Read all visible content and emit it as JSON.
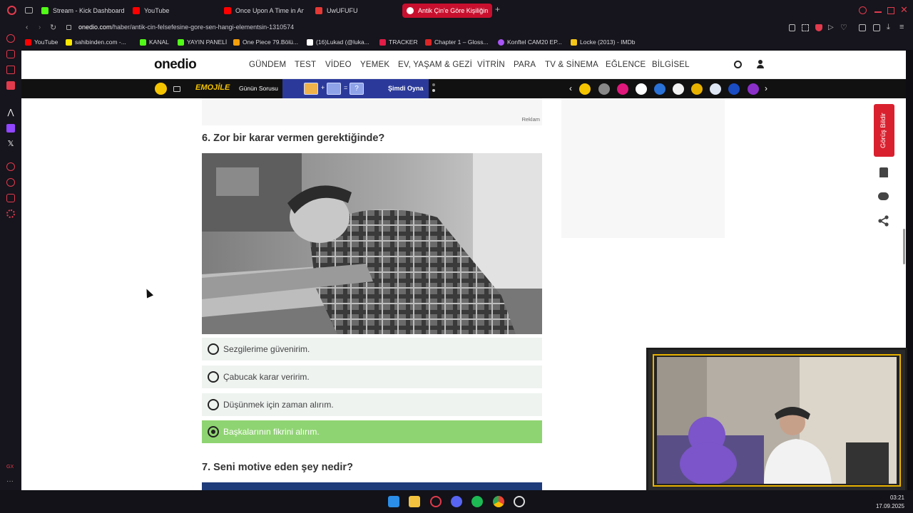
{
  "browser": {
    "tabs": [
      {
        "label": "Stream - Kick Dashboard",
        "color": "#53fc18"
      },
      {
        "label": "YouTube",
        "color": "#ff0000"
      },
      {
        "label": "Once Upon A Time in Ana",
        "color": "#ff0000"
      },
      {
        "label": "UwUFUFU",
        "color": "#e53935"
      },
      {
        "label": "Antik Çin'e Göre Kişiliğin",
        "color": "#ffffff",
        "active": true
      }
    ],
    "url_domain": "onedio.com",
    "url_path": "/haber/antik-cin-felsefesine-gore-sen-hangi-elementsin-1310574",
    "bookmarks": [
      {
        "label": "YouTube",
        "color": "#ff0000"
      },
      {
        "label": "sahibinden.com -...",
        "color": "#ffe800"
      },
      {
        "label": "KANAL",
        "color": "#53fc18"
      },
      {
        "label": "YAYIN PANELİ",
        "color": "#53fc18"
      },
      {
        "label": "One Piece 79.Bölü...",
        "color": "#f59e0b"
      },
      {
        "label": "(16)Lukad (@luka...",
        "color": "#ffffff"
      },
      {
        "label": "TRACKER",
        "color": "#e11d48"
      },
      {
        "label": "Chapter 1 – Gloss...",
        "color": "#dc2626"
      },
      {
        "label": "Konftel CAM20 EP...",
        "color": "#a855f7"
      },
      {
        "label": "Locke (2013) - IMDb",
        "color": "#f5c518"
      }
    ]
  },
  "site": {
    "logo": "onedio",
    "nav": [
      "GÜNDEM",
      "TEST",
      "VİDEO",
      "YEMEK",
      "EV, YAŞAM & GEZİ",
      "VİTRİN",
      "PARA",
      "TV & SİNEMA",
      "EĞLENCE",
      "BİLGİSEL"
    ],
    "subbar": {
      "game": "EMOJİLE",
      "daily": "Günün Sorusu",
      "play": "Şimdi Oyna"
    },
    "ad_label": "Reklam",
    "feedback": "Görüş Bildir"
  },
  "article": {
    "q6": {
      "title": "6. Zor bir karar vermen gerektiğinde?",
      "options": [
        {
          "label": "Sezgilerime güvenirim.",
          "selected": false
        },
        {
          "label": "Çabucak karar veririm.",
          "selected": false
        },
        {
          "label": "Düşünmek için zaman alırım.",
          "selected": false
        },
        {
          "label": "Başkalarının fikrini alırım.",
          "selected": true
        }
      ]
    },
    "q7": {
      "title": "7. Seni motive eden şey nedir?"
    }
  },
  "taskbar": {
    "time": "03:21",
    "date": "17.09.2025"
  },
  "colors": {
    "selected_option": "#8fd472",
    "accent": "#d9202f"
  }
}
